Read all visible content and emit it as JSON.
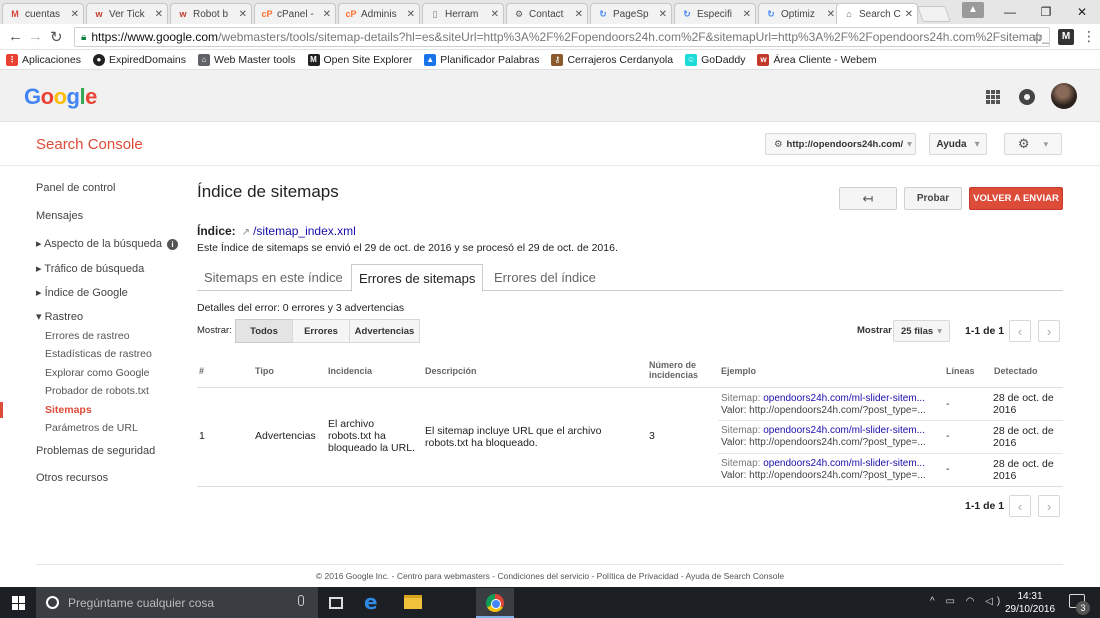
{
  "browser": {
    "tabs": [
      {
        "label": "cuentas",
        "fav": "M",
        "color": "#d44638"
      },
      {
        "label": "Ver Tick",
        "fav": "w",
        "color": "#c0392b"
      },
      {
        "label": "Robot b",
        "fav": "w",
        "color": "#c0392b"
      },
      {
        "label": "cPanel -",
        "fav": "cP",
        "color": "#ff6c2c"
      },
      {
        "label": "Adminis",
        "fav": "cP",
        "color": "#ff6c2c"
      },
      {
        "label": "Herram",
        "fav": "▯",
        "color": "#777777"
      },
      {
        "label": "Contact",
        "fav": "⚙",
        "color": "#555555"
      },
      {
        "label": "PageSp",
        "fav": "↻",
        "color": "#4285f4"
      },
      {
        "label": "Especifi",
        "fav": "↻",
        "color": "#4285f4"
      },
      {
        "label": "Optimiz",
        "fav": "↻",
        "color": "#4285f4"
      },
      {
        "label": "Search C",
        "fav": "⌂",
        "color": "#5f6368"
      }
    ],
    "url_main": "https://www.google.com",
    "url_rest": "/webmasters/tools/sitemap-details?hl=es&siteUrl=http%3A%2F%2Fopendoors24h.com%2F&sitemapUrl=http%3A%2F%2Fopendoors24h.com%2Fsitemap_index.",
    "ext_label": "M",
    "bookmarks": [
      {
        "label": "Aplicaciones",
        "icon": "apps-icon",
        "color": "#e94235"
      },
      {
        "label": "ExpiredDomains",
        "icon": "globe-icon",
        "color": "#222222"
      },
      {
        "label": "Web Master tools",
        "icon": "webmaster-icon",
        "color": "#5f6368"
      },
      {
        "label": "Open Site Explorer",
        "icon": "m-icon",
        "color": "#222222"
      },
      {
        "label": "Planificador Palabras",
        "icon": "adwords-icon",
        "color": "#1a73e8"
      },
      {
        "label": "Cerrajeros Cerdanyola",
        "icon": "key-icon",
        "color": "#8b5a2b"
      },
      {
        "label": "GoDaddy",
        "icon": "godaddy-icon",
        "color": "#1bdbdb"
      },
      {
        "label": "Área Cliente - Webem",
        "icon": "w-icon",
        "color": "#c0392b"
      }
    ]
  },
  "google": {
    "logo": [
      {
        "ch": "G",
        "color": "#4285f4"
      },
      {
        "ch": "o",
        "color": "#ea4335"
      },
      {
        "ch": "o",
        "color": "#fbbc05"
      },
      {
        "ch": "g",
        "color": "#4285f4"
      },
      {
        "ch": "l",
        "color": "#34a853"
      },
      {
        "ch": "e",
        "color": "#ea4335"
      }
    ]
  },
  "console": {
    "title": "Search Console",
    "site": "http://opendoors24h.com/",
    "help": "Ayuda"
  },
  "sidebar": {
    "items": [
      {
        "label": "Panel de control"
      },
      {
        "label": "Mensajes"
      },
      {
        "label": "▸ Aspecto de la búsqueda"
      },
      {
        "label": "▸ Tráfico de búsqueda"
      },
      {
        "label": "▸ Índice de Google"
      },
      {
        "label": "▾ Rastreo"
      }
    ],
    "sub": [
      {
        "label": "Errores de rastreo"
      },
      {
        "label": "Estadísticas de rastreo"
      },
      {
        "label": "Explorar como Google"
      },
      {
        "label": "Probador de robots.txt"
      },
      {
        "label": "Sitemaps"
      },
      {
        "label": "Parámetros de URL"
      }
    ],
    "bottom": [
      {
        "label": "Problemas de seguridad"
      },
      {
        "label": "Otros recursos"
      }
    ]
  },
  "main": {
    "title": "Índice de sitemaps",
    "back_icon": "↤",
    "test_label": "Probar",
    "resend_label": "VOLVER A ENVIAR",
    "index_label": "Índice:",
    "index_link": "/sitemap_index.xml",
    "index_info": "Este Índice de sitemaps se envió el 29 de oct. de 2016 y se procesó el 29 de oct. de 2016.",
    "tabs": [
      {
        "label": "Sitemaps en este índice"
      },
      {
        "label": "Errores de sitemaps"
      },
      {
        "label": "Errores del índice"
      }
    ],
    "error_details": "Detalles del error: 0 errores y 3 advertencias",
    "show_label": "Mostrar:",
    "filters": [
      {
        "label": "Todos"
      },
      {
        "label": "Errores"
      },
      {
        "label": "Advertencias"
      }
    ],
    "rows_label": "Mostrar",
    "rows_value": "25 filas",
    "pager": "1-1 de 1"
  },
  "table": {
    "headers": {
      "num": "#",
      "type": "Tipo",
      "issue": "Incidencia",
      "desc": "Descripción",
      "count_1": "Número de",
      "count_2": "incidencias",
      "example": "Ejemplo",
      "lines": "Líneas",
      "detected": "Detectado"
    },
    "row": {
      "num": "1",
      "type": "Advertencias",
      "issue_1": "El archivo",
      "issue_2": "robots.txt ha",
      "issue_3": "bloqueado la URL.",
      "desc_1": "El sitemap incluye URL que el archivo",
      "desc_2": "robots.txt ha bloqueado.",
      "count": "3"
    },
    "examples": [
      {
        "sitemap_label": "Sitemap: ",
        "sitemap": "opendoors24h.com/ml-slider-sitem...",
        "value": "Valor: http://opendoors24h.com/?post_type=...",
        "lines": "-",
        "date_1": "28 de oct. de",
        "date_2": "2016"
      },
      {
        "sitemap_label": "Sitemap: ",
        "sitemap": "opendoors24h.com/ml-slider-sitem...",
        "value": "Valor: http://opendoors24h.com/?post_type=...",
        "lines": "-",
        "date_1": "28 de oct. de",
        "date_2": "2016"
      },
      {
        "sitemap_label": "Sitemap: ",
        "sitemap": "opendoors24h.com/ml-slider-sitem...",
        "value": "Valor: http://opendoors24h.com/?post_type=...",
        "lines": "-",
        "date_1": "28 de oct. de",
        "date_2": "2016"
      }
    ]
  },
  "footer": "© 2016 Google Inc. - Centro para webmasters - Condiciones del servicio - Política de Privacidad - Ayuda de Search Console",
  "taskbar": {
    "search_placeholder": "Pregúntame cualquier cosa",
    "tray_icons": "^ ▭ ◠ ◁)",
    "time": "14:31",
    "date": "29/10/2016",
    "notif_count": "3"
  }
}
